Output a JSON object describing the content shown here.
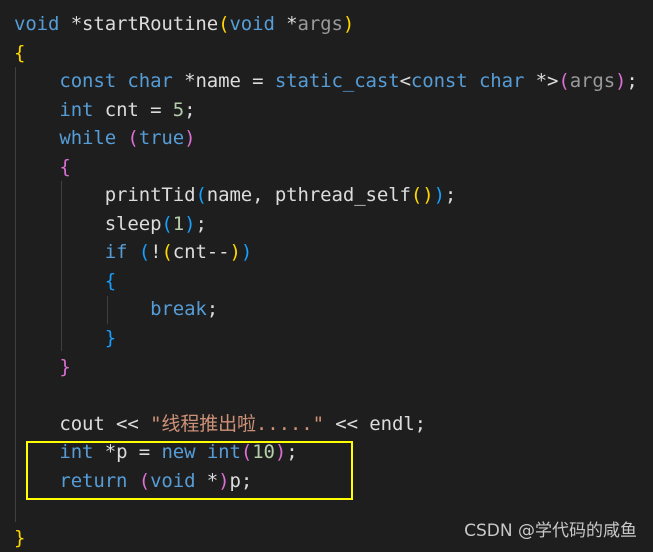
{
  "editor": {
    "theme_colors": {
      "background": "#1e1e1e",
      "keyword": "#569cd6",
      "text": "#dcdcdc",
      "parameter": "#9a9a9a",
      "number": "#b5cea8",
      "string": "#ce9178",
      "bracket1": "#ffd700",
      "bracket2": "#da70d6",
      "bracket3": "#179fff",
      "highlight_box": "#ffff00"
    },
    "lines": [
      [
        [
          "void",
          "kw"
        ],
        [
          " *startRoutine",
          "fn"
        ],
        [
          "(",
          "b1"
        ],
        [
          "void",
          "kw"
        ],
        [
          " *",
          "fn"
        ],
        [
          "args",
          "par"
        ],
        [
          ")",
          "b1"
        ]
      ],
      [
        [
          "{",
          "b1"
        ]
      ],
      [
        [
          "    ",
          ""
        ],
        [
          "const",
          "kw"
        ],
        [
          " ",
          ""
        ],
        [
          "char",
          "kw"
        ],
        [
          " *name = ",
          ""
        ],
        [
          "static_cast",
          "kw"
        ],
        [
          "<",
          ""
        ],
        [
          "const",
          "kw"
        ],
        [
          " ",
          ""
        ],
        [
          "char",
          "kw"
        ],
        [
          " *>",
          ""
        ],
        [
          "(",
          "b2"
        ],
        [
          "args",
          "par"
        ],
        [
          ")",
          "b2"
        ],
        [
          ";",
          ""
        ]
      ],
      [
        [
          "    ",
          ""
        ],
        [
          "int",
          "kw"
        ],
        [
          " cnt = ",
          ""
        ],
        [
          "5",
          "num"
        ],
        [
          ";",
          ""
        ]
      ],
      [
        [
          "    ",
          ""
        ],
        [
          "while",
          "kw"
        ],
        [
          " ",
          ""
        ],
        [
          "(",
          "b2"
        ],
        [
          "true",
          "kw"
        ],
        [
          ")",
          "b2"
        ]
      ],
      [
        [
          "    ",
          ""
        ],
        [
          "{",
          "b2"
        ]
      ],
      [
        [
          "        printTid",
          ""
        ],
        [
          "(",
          "b3"
        ],
        [
          "name, pthread_self",
          ""
        ],
        [
          "()",
          "b1"
        ],
        [
          ")",
          "b3"
        ],
        [
          ";",
          ""
        ]
      ],
      [
        [
          "        sleep",
          ""
        ],
        [
          "(",
          "b3"
        ],
        [
          "1",
          "num"
        ],
        [
          ")",
          "b3"
        ],
        [
          ";",
          ""
        ]
      ],
      [
        [
          "        ",
          ""
        ],
        [
          "if",
          "kw"
        ],
        [
          " ",
          ""
        ],
        [
          "(",
          "b3"
        ],
        [
          "!",
          ""
        ],
        [
          "(",
          "b1"
        ],
        [
          "cnt--",
          ""
        ],
        [
          ")",
          "b1"
        ],
        [
          ")",
          "b3"
        ]
      ],
      [
        [
          "        ",
          ""
        ],
        [
          "{",
          "b3"
        ]
      ],
      [
        [
          "            ",
          ""
        ],
        [
          "break",
          "kw"
        ],
        [
          ";",
          ""
        ]
      ],
      [
        [
          "        ",
          ""
        ],
        [
          "}",
          "b3"
        ]
      ],
      [
        [
          "    ",
          ""
        ],
        [
          "}",
          "b2"
        ]
      ],
      [
        [
          "",
          ""
        ]
      ],
      [
        [
          "    cout << ",
          ""
        ],
        [
          "\"线程推出啦.....\"",
          "str"
        ],
        [
          " << endl;",
          ""
        ]
      ],
      [
        [
          "    ",
          ""
        ],
        [
          "int",
          "kw"
        ],
        [
          " *p = ",
          ""
        ],
        [
          "new",
          "kw"
        ],
        [
          " ",
          ""
        ],
        [
          "int",
          "kw"
        ],
        [
          "(",
          "b2"
        ],
        [
          "10",
          "num"
        ],
        [
          ")",
          "b2"
        ],
        [
          ";",
          ""
        ]
      ],
      [
        [
          "    ",
          ""
        ],
        [
          "return",
          "kw"
        ],
        [
          " ",
          ""
        ],
        [
          "(",
          "b2"
        ],
        [
          "void",
          "kw"
        ],
        [
          " *",
          ""
        ],
        [
          ")",
          "b2"
        ],
        [
          "p;",
          ""
        ]
      ],
      [
        [
          "",
          ""
        ]
      ],
      [
        [
          "}",
          "b1"
        ]
      ]
    ]
  },
  "watermark": "CSDN @学代码的咸鱼"
}
